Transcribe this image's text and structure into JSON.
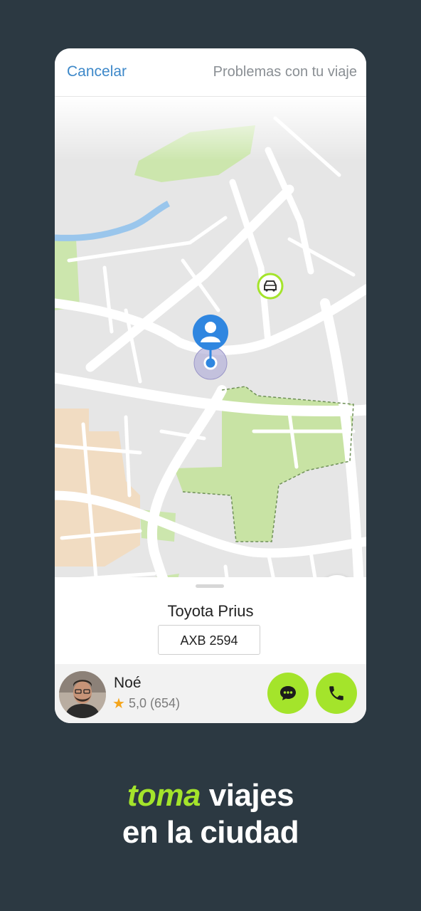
{
  "topbar": {
    "cancel_label": "Cancelar",
    "problems_label": "Problemas con tu viaje"
  },
  "map": {
    "icons": [
      "car-icon",
      "user-pin-icon",
      "location-dot-icon",
      "shield-check-icon"
    ],
    "colors": {
      "park": "#c8e3a4",
      "water": "#9ac6ec",
      "pin": "#2f86e0",
      "accent": "#a4e42b"
    }
  },
  "trip": {
    "car_model": "Toyota Prius",
    "plate": "AXB 2594"
  },
  "driver": {
    "name": "Noé",
    "rating": "5,0 (654)",
    "icons": [
      "star-icon",
      "chat-icon",
      "phone-icon"
    ]
  },
  "tagline": {
    "brand": "toma",
    "line1_rest": " viajes",
    "line2": "en la ciudad"
  }
}
